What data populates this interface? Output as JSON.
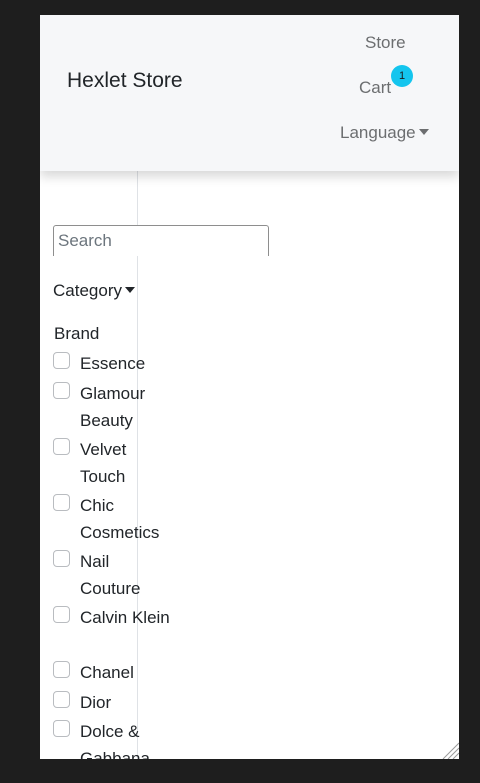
{
  "navbar": {
    "brand": "Hexlet Store",
    "store_label": "Store",
    "cart_label": "Cart",
    "cart_count": "1",
    "language_label": "Language"
  },
  "sidebar": {
    "search_placeholder": "Search",
    "category_label": "Category",
    "brand_heading": "Brand",
    "brands": [
      {
        "label": "Essence"
      },
      {
        "label": "Glamour Beauty"
      },
      {
        "label": "Velvet Touch"
      },
      {
        "label": "Chic Cosmetics"
      },
      {
        "label": "Nail Couture"
      },
      {
        "label": "Calvin Klein"
      },
      {
        "label": "Chanel"
      },
      {
        "label": "Dior"
      },
      {
        "label": "Dolce & Gabbana"
      }
    ]
  },
  "colors": {
    "badge": "#14c5ee",
    "navbar_bg": "#f6f7f9"
  }
}
